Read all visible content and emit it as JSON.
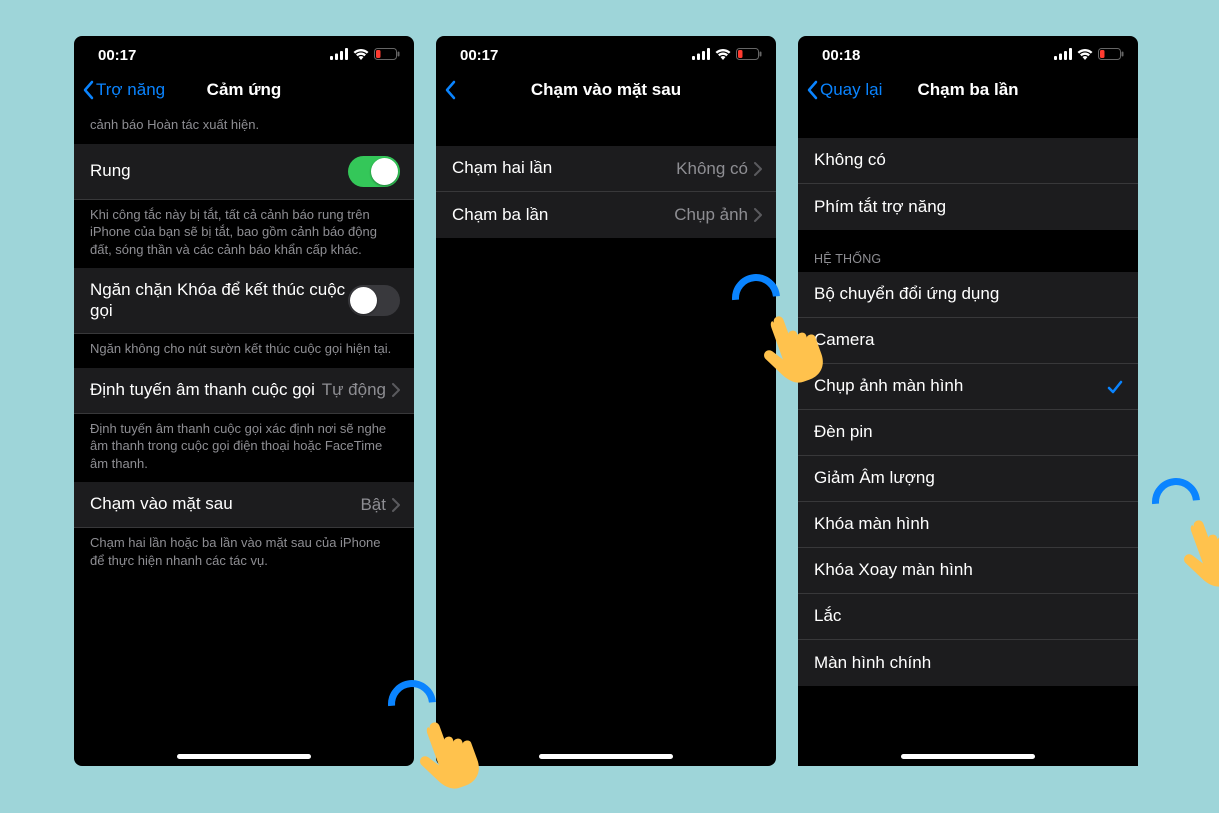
{
  "screens": [
    {
      "status_time": "00:17",
      "back_label": "Trợ năng",
      "title": "Cảm ứng",
      "intro_fragment": "cảnh báo Hoàn tác xuất hiện.",
      "rows": {
        "vibration": {
          "label": "Rung",
          "desc": "Khi công tắc này bị tắt, tất cả cảnh báo rung trên iPhone của bạn sẽ bị tắt, bao gồm cảnh báo động đất, sóng thần và các cảnh báo khẩn cấp khác."
        },
        "lock_end_call": {
          "label": "Ngăn chặn Khóa để kết thúc cuộc gọi",
          "desc": "Ngăn không cho nút sườn kết thúc cuộc gọi hiện tại."
        },
        "audio_routing": {
          "label": "Định tuyến âm thanh cuộc gọi",
          "value": "Tự động",
          "desc": "Định tuyến âm thanh cuộc gọi xác định nơi sẽ nghe âm thanh trong cuộc gọi điện thoại hoặc FaceTime âm thanh."
        },
        "back_tap": {
          "label": "Chạm vào mặt sau",
          "value": "Bật",
          "desc": "Chạm hai lần hoặc ba lần vào mặt sau của iPhone để thực hiện nhanh các tác vụ."
        }
      }
    },
    {
      "status_time": "00:17",
      "title": "Chạm vào mặt sau",
      "rows": {
        "double_tap": {
          "label": "Chạm hai lần",
          "value": "Không có"
        },
        "triple_tap": {
          "label": "Chạm ba lần",
          "value": "Chụp ảnh"
        }
      }
    },
    {
      "status_time": "00:18",
      "back_label": "Quay lại",
      "title": "Chạm ba lần",
      "top_rows": {
        "none": "Không có",
        "shortcut": "Phím tắt trợ năng"
      },
      "system_header": "HỆ THỐNG",
      "system_rows": [
        "Bộ chuyển đổi ứng dụng",
        "Camera",
        "Chụp ảnh màn hình",
        "Đèn pin",
        "Giảm Âm lượng",
        "Khóa màn hình",
        "Khóa Xoay màn hình",
        "Lắc",
        "Màn hình chính"
      ],
      "selected_index": 2
    }
  ]
}
